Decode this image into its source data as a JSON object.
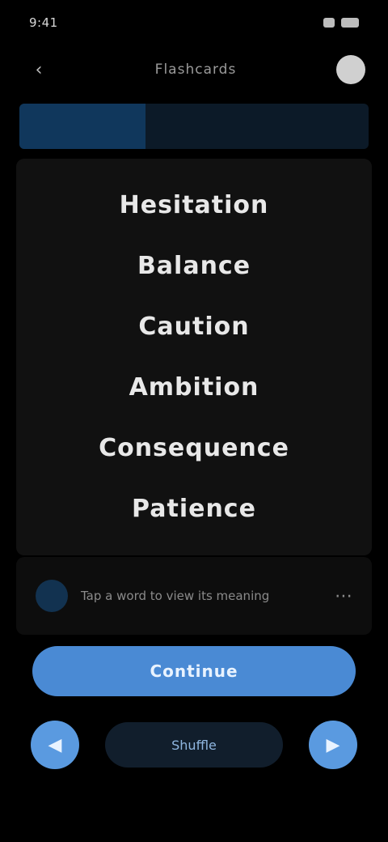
{
  "status": {
    "time": "9:41"
  },
  "top_bar": {
    "title": "Flashcards"
  },
  "progress": {
    "fraction": 0.36
  },
  "panel": {
    "words": [
      "Hesitation",
      "Balance",
      "Caution",
      "Ambition",
      "Consequence",
      "Patience"
    ]
  },
  "hint": {
    "text": "Tap a word to view its meaning"
  },
  "actions": {
    "primary": "Continue",
    "secondary": "Shuffle"
  },
  "footer": {
    "text": ""
  },
  "colors": {
    "accent": "#4a8ad4",
    "progress": "#10375c"
  }
}
